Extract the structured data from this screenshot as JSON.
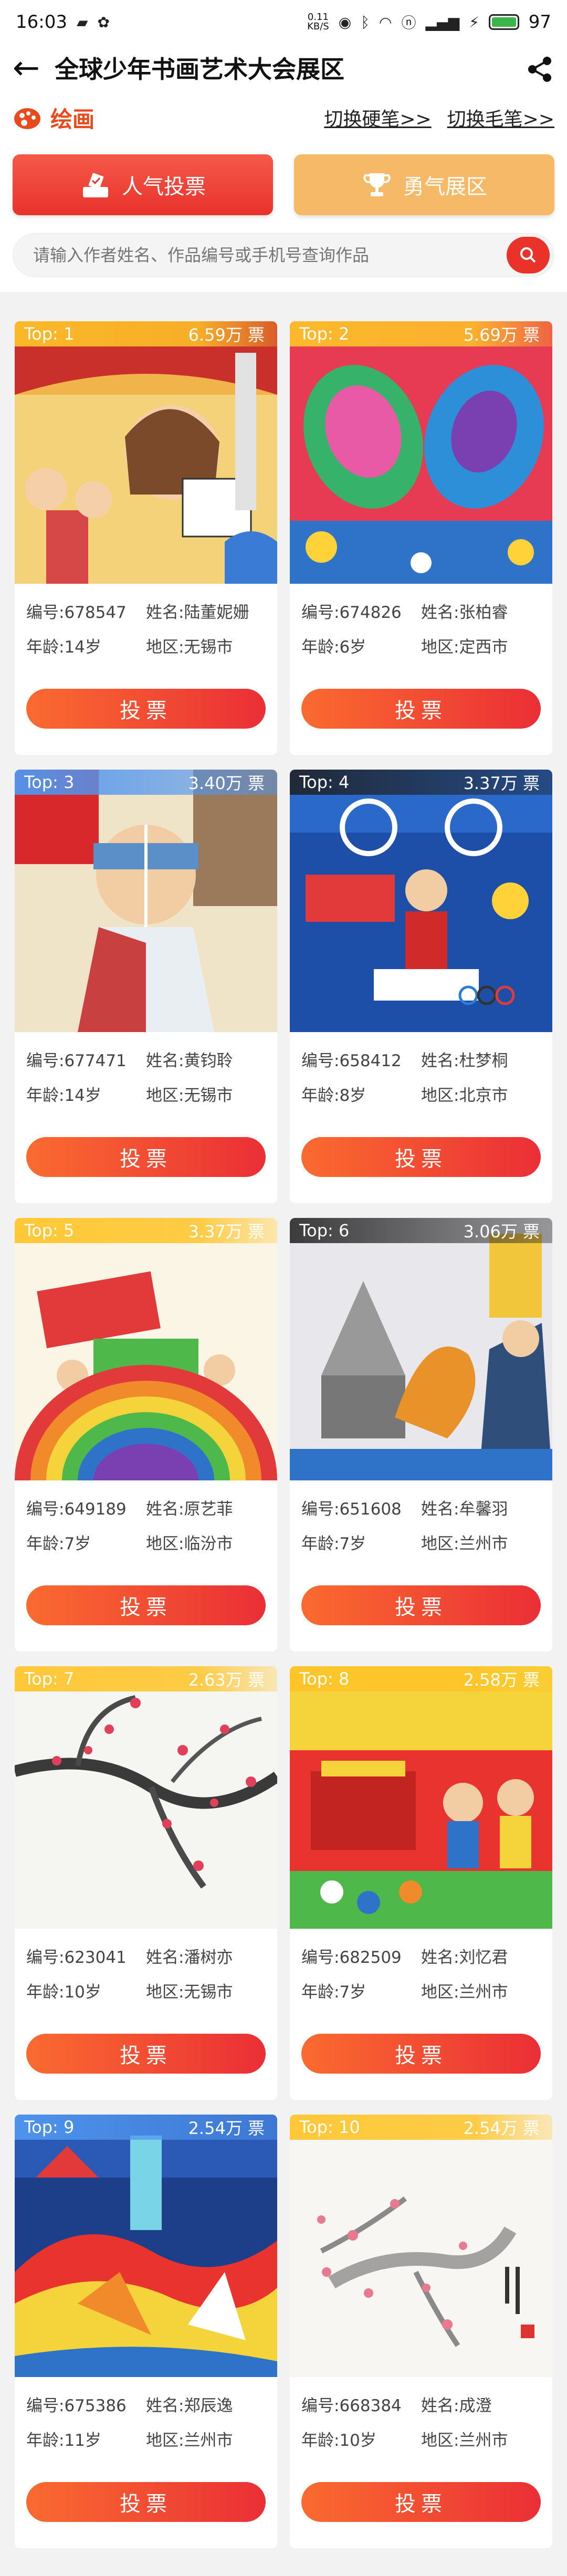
{
  "status": {
    "time": "16:03",
    "net_top": "0.11",
    "net_bottom": "KB/S",
    "battery": "97"
  },
  "header": {
    "title": "全球少年书画艺术大会展区"
  },
  "category": {
    "label": "绘画",
    "switch_pen": "切换硬笔>>",
    "switch_brush": "切换毛笔>>"
  },
  "tabs": [
    {
      "label": "人气投票"
    },
    {
      "label": "勇气展区"
    }
  ],
  "search": {
    "placeholder": "请输入作者姓名、作品编号或手机号查询作品"
  },
  "cards": [
    {
      "rank": "Top: 1",
      "votes": "6.59万 票",
      "id_label": "编号:678547",
      "name_label": "姓名:陆董妮姗",
      "age_label": "年龄:14岁",
      "region_label": "地区:无锡市",
      "vote_label": "投票"
    },
    {
      "rank": "Top: 2",
      "votes": "5.69万 票",
      "id_label": "编号:674826",
      "name_label": "姓名:张柏睿",
      "age_label": "年龄:6岁",
      "region_label": "地区:定西市",
      "vote_label": "投票"
    },
    {
      "rank": "Top: 3",
      "votes": "3.40万 票",
      "id_label": "编号:677471",
      "name_label": "姓名:黄钧聆",
      "age_label": "年龄:14岁",
      "region_label": "地区:无锡市",
      "vote_label": "投票"
    },
    {
      "rank": "Top: 4",
      "votes": "3.37万 票",
      "id_label": "编号:658412",
      "name_label": "姓名:杜梦桐",
      "age_label": "年龄:8岁",
      "region_label": "地区:北京市",
      "vote_label": "投票"
    },
    {
      "rank": "Top: 5",
      "votes": "3.37万 票",
      "id_label": "编号:649189",
      "name_label": "姓名:原艺菲",
      "age_label": "年龄:7岁",
      "region_label": "地区:临汾市",
      "vote_label": "投票"
    },
    {
      "rank": "Top: 6",
      "votes": "3.06万 票",
      "id_label": "编号:651608",
      "name_label": "姓名:牟馨羽",
      "age_label": "年龄:7岁",
      "region_label": "地区:兰州市",
      "vote_label": "投票"
    },
    {
      "rank": "Top: 7",
      "votes": "2.63万 票",
      "id_label": "编号:623041",
      "name_label": "姓名:潘树亦",
      "age_label": "年龄:10岁",
      "region_label": "地区:无锡市",
      "vote_label": "投票"
    },
    {
      "rank": "Top: 8",
      "votes": "2.58万 票",
      "id_label": "编号:682509",
      "name_label": "姓名:刘忆君",
      "age_label": "年龄:7岁",
      "region_label": "地区:兰州市",
      "vote_label": "投票"
    },
    {
      "rank": "Top: 9",
      "votes": "2.54万 票",
      "id_label": "编号:675386",
      "name_label": "姓名:郑辰逸",
      "age_label": "年龄:11岁",
      "region_label": "地区:兰州市",
      "vote_label": "投票"
    },
    {
      "rank": "Top: 10",
      "votes": "2.54万 票",
      "id_label": "编号:668384",
      "name_label": "姓名:成澄",
      "age_label": "年龄:10岁",
      "region_label": "地区:兰州市",
      "vote_label": "投票"
    }
  ],
  "colors": {
    "accent": "#e8322a",
    "gold": "#f6b967",
    "rank_banner": "#ffc428"
  }
}
